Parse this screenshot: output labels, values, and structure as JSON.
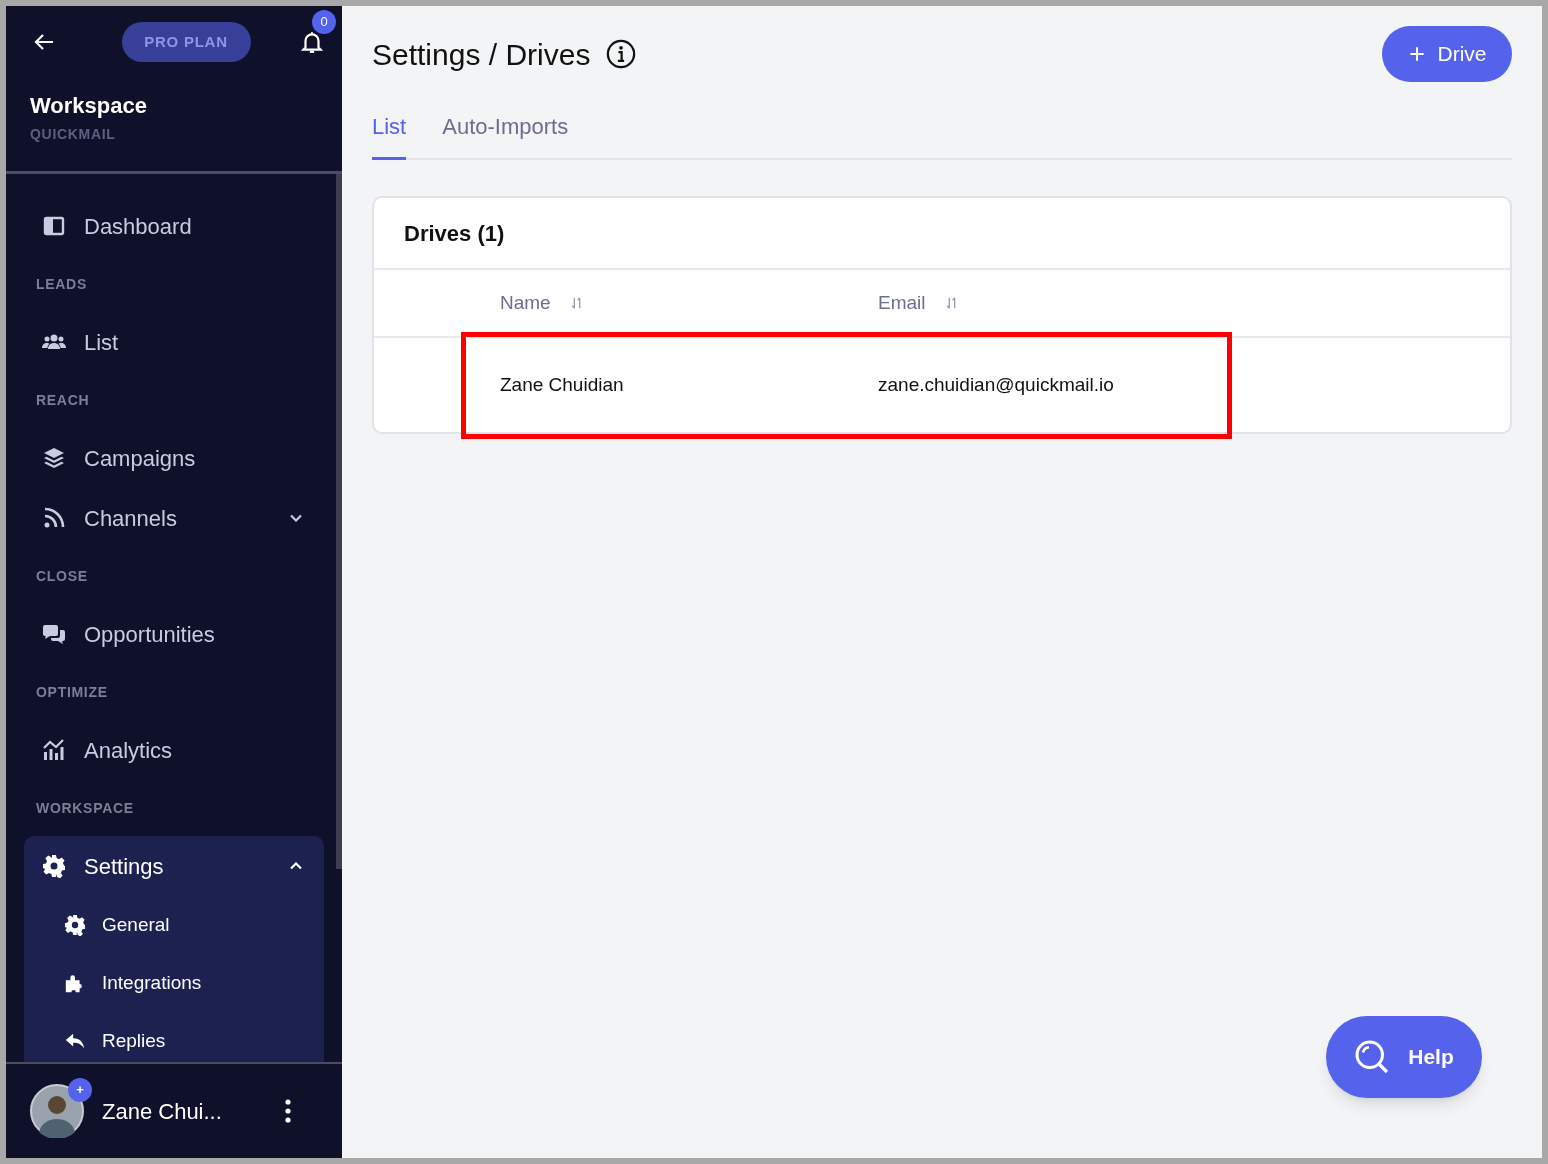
{
  "sidebar": {
    "plan_badge": "PRO PLAN",
    "notification_count": "0",
    "workspace": {
      "title": "Workspace",
      "subtitle": "QUICKMAIL"
    },
    "nav": [
      {
        "kind": "item",
        "label": "Dashboard"
      },
      {
        "kind": "section",
        "label": "LEADS"
      },
      {
        "kind": "item",
        "label": "List"
      },
      {
        "kind": "section",
        "label": "REACH"
      },
      {
        "kind": "item",
        "label": "Campaigns"
      },
      {
        "kind": "item",
        "label": "Channels",
        "expanded": false
      },
      {
        "kind": "section",
        "label": "CLOSE"
      },
      {
        "kind": "item",
        "label": "Opportunities"
      },
      {
        "kind": "section",
        "label": "OPTIMIZE"
      },
      {
        "kind": "item",
        "label": "Analytics"
      },
      {
        "kind": "section",
        "label": "WORKSPACE"
      },
      {
        "kind": "group",
        "label": "Settings",
        "expanded": true,
        "children": [
          {
            "label": "General"
          },
          {
            "label": "Integrations"
          },
          {
            "label": "Replies"
          }
        ]
      }
    ],
    "user": {
      "name": "Zane Chui...",
      "badge": "+"
    }
  },
  "main": {
    "title": "Settings / Drives",
    "add_button": "Drive",
    "tabs": [
      {
        "label": "List",
        "selected": true
      },
      {
        "label": "Auto-Imports",
        "selected": false
      }
    ],
    "card": {
      "title": "Drives (1)",
      "columns": [
        "Name",
        "Email"
      ],
      "rows": [
        {
          "cells": [
            "Zane Chuidian",
            "zane.chuidian@quickmail.io"
          ],
          "highlighted": true
        }
      ]
    },
    "help_button": "Help"
  }
}
